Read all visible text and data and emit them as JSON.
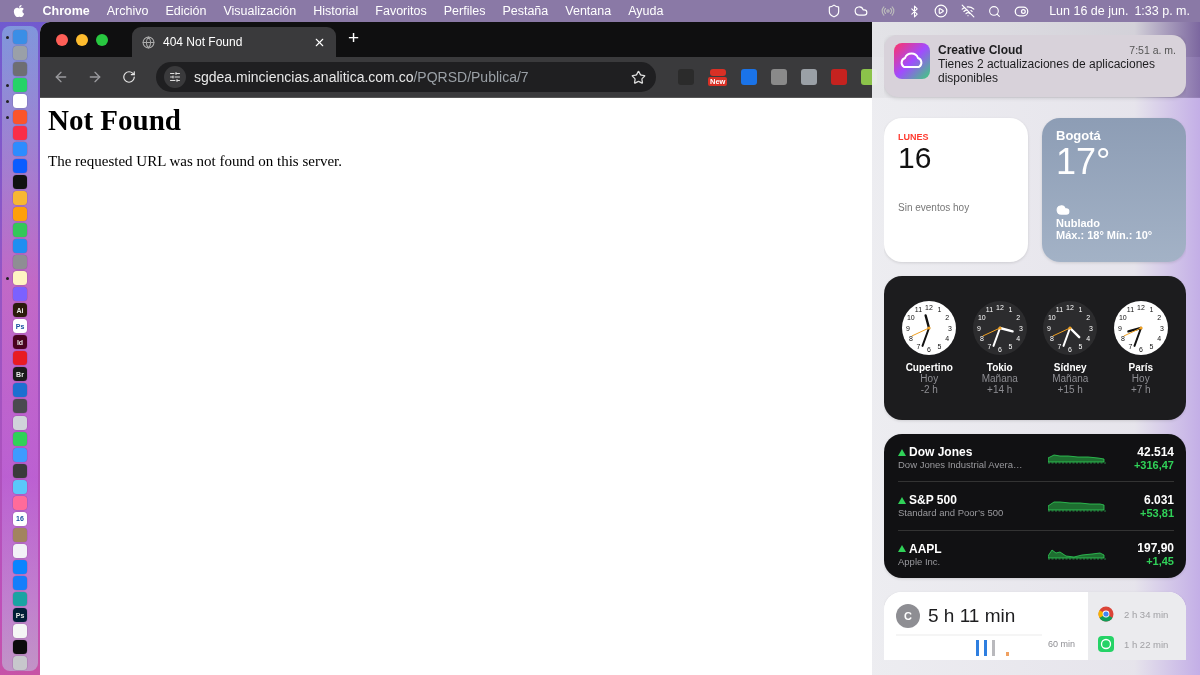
{
  "menu_bar": {
    "app": "Chrome",
    "menus": [
      "Archivo",
      "Edición",
      "Visualización",
      "Historial",
      "Favoritos",
      "Perfiles",
      "Pestaña",
      "Ventana",
      "Ayuda"
    ],
    "date": "Lun 16 de jun.",
    "time": "1:33 p. m."
  },
  "dock": {
    "apps": [
      {
        "color": "#3a8ee6",
        "running": true
      },
      {
        "color": "#9aa0a8",
        "running": false
      },
      {
        "color": "#6e6e73",
        "running": false
      },
      {
        "color": "#25d366",
        "running": true
      },
      {
        "color": "#ffffff",
        "running": true
      },
      {
        "color": "#fb542b",
        "running": true
      },
      {
        "color": "#fa2d48",
        "running": false
      },
      {
        "color": "#2d8cff",
        "running": false
      },
      {
        "color": "#0b5cff",
        "running": false
      },
      {
        "color": "#111111",
        "running": false
      },
      {
        "color": "#f7b733",
        "running": false
      },
      {
        "color": "#ff9f0a",
        "running": false
      },
      {
        "color": "#34c759",
        "running": false
      },
      {
        "color": "#1f8ef1",
        "running": false
      },
      {
        "color": "#8e8e93",
        "running": false
      },
      {
        "color": "#fff4c2",
        "running": true
      },
      {
        "color": "#7b61ff",
        "running": false
      },
      {
        "color": "#2b1a0b",
        "label": "Ai",
        "running": false
      },
      {
        "color": "#ffffff",
        "label": "Ps",
        "running": false
      },
      {
        "color": "#49021f",
        "label": "Id",
        "running": false
      },
      {
        "color": "#e81b23",
        "running": false
      },
      {
        "color": "#1a1a1a",
        "label": "Br",
        "running": false
      },
      {
        "color": "#1c6fd1",
        "running": false
      },
      {
        "color": "#4a4a4f",
        "running": false
      },
      {
        "color": "#d0d4da",
        "running": false
      },
      {
        "color": "#30d158",
        "running": false
      },
      {
        "color": "#3d9bff",
        "running": false
      },
      {
        "color": "#3a3a3c",
        "running": false
      },
      {
        "color": "#5ac8fa",
        "running": false
      },
      {
        "color": "#ff6b9a",
        "running": false
      },
      {
        "color": "#ffffff",
        "label": "16",
        "running": false
      },
      {
        "color": "#a2845e",
        "running": false
      },
      {
        "color": "#f2f2f7",
        "running": false
      },
      {
        "color": "#0a84ff",
        "running": false
      },
      {
        "color": "#147efb",
        "running": false
      },
      {
        "color": "#1aa3a3",
        "running": false
      },
      {
        "color": "#001e36",
        "label": "Ps",
        "running": false
      },
      {
        "color": "#f5f5f5",
        "running": false
      },
      {
        "color": "#0c0c0c",
        "running": false
      },
      {
        "color": "#c7c7cc",
        "running": false
      }
    ]
  },
  "browser": {
    "tab": {
      "title": "404 Not Found",
      "selected": true
    },
    "new_tab": "+",
    "address": {
      "host": "sgdea.minciencias.analitica.com.co",
      "path": "/PQRSD/Publica/7"
    },
    "extensions": [
      {
        "color": "#2b2b2b"
      },
      {
        "color": "#d93025",
        "badge": "New"
      },
      {
        "color": "#1a73e8"
      },
      {
        "color": "#8a8a8a"
      },
      {
        "color": "#9aa0a6"
      },
      {
        "color": "#c5221f"
      },
      {
        "color": "#8bc34a"
      }
    ]
  },
  "page": {
    "heading": "Not Found",
    "message": "The requested URL was not found on this server."
  },
  "notification": {
    "app": "Creative Cloud",
    "time": "7:51 a. m.",
    "body": "Tienes 2 actualizaciones de aplicaciones disponibles"
  },
  "calendar": {
    "weekday": "LUNES",
    "day": "16",
    "events": "Sin eventos hoy"
  },
  "weather": {
    "city": "Bogotá",
    "temperature": "17°",
    "condition": "Nublado",
    "range": "Máx.: 18° Mín.: 10°"
  },
  "world_clocks": [
    {
      "city": "Cupertino",
      "day": "Hoy",
      "offset": "-2 h",
      "dark": false,
      "numerals": [
        "11",
        "12",
        "1",
        "10",
        "2",
        "9",
        "3",
        "8",
        "4",
        "7",
        "6",
        "5"
      ]
    },
    {
      "city": "Tokio",
      "day": "Mañana",
      "offset": "+14 h",
      "dark": true,
      "numerals": [
        "11",
        "12",
        "1",
        "10",
        "2",
        "9",
        "3",
        "8",
        "4",
        "7",
        "6",
        "5"
      ]
    },
    {
      "city": "Sídney",
      "day": "Mañana",
      "offset": "+15 h",
      "dark": true,
      "numerals": [
        "11",
        "12",
        "1",
        "10",
        "2",
        "9",
        "3",
        "8",
        "4",
        "7",
        "6",
        "5"
      ]
    },
    {
      "city": "París",
      "day": "Hoy",
      "offset": "+7 h",
      "dark": false,
      "numerals": [
        "11",
        "12",
        "1",
        "10",
        "2",
        "9",
        "3",
        "8",
        "4",
        "7",
        "6",
        "5"
      ]
    }
  ],
  "stocks": [
    {
      "symbol": "Dow Jones",
      "name": "Dow Jones Industrial Avera…",
      "price": "42.514",
      "change": "+316,47"
    },
    {
      "symbol": "S&P 500",
      "name": "Standard and Poor’s 500",
      "price": "6.031",
      "change": "+53,81"
    },
    {
      "symbol": "AAPL",
      "name": "Apple Inc.",
      "price": "197,90",
      "change": "+1,45"
    }
  ],
  "screen_time": {
    "avatar": "C",
    "total": "5 h 11 min",
    "scale": "60 min",
    "apps": [
      {
        "kind": "chrome",
        "time": "2 h 34 min"
      },
      {
        "kind": "whatsapp",
        "time": "1 h 22 min"
      }
    ]
  }
}
